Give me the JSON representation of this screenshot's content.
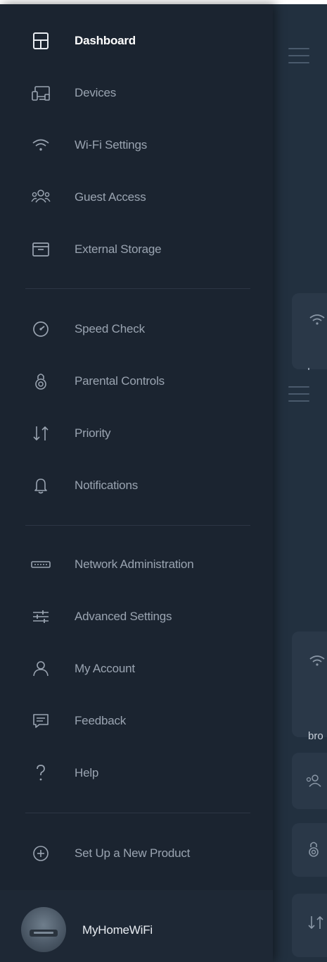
{
  "drawer": {
    "accent_color": "#ffffff",
    "label_color": "#9aa4b1",
    "groups": [
      [
        {
          "label": "Dashboard",
          "icon": "dashboard-icon",
          "active": true
        },
        {
          "label": "Devices",
          "icon": "devices-icon"
        },
        {
          "label": "Wi-Fi Settings",
          "icon": "wifi-icon"
        },
        {
          "label": "Guest Access",
          "icon": "guest-access-icon"
        },
        {
          "label": "External Storage",
          "icon": "storage-box-icon"
        }
      ],
      [
        {
          "label": "Speed Check",
          "icon": "speedometer-icon"
        },
        {
          "label": "Parental Controls",
          "icon": "parental-controls-icon"
        },
        {
          "label": "Priority",
          "icon": "priority-arrows-icon"
        },
        {
          "label": "Notifications",
          "icon": "bell-icon"
        }
      ],
      [
        {
          "label": "Network Administration",
          "icon": "router-icon"
        },
        {
          "label": "Advanced Settings",
          "icon": "sliders-icon"
        },
        {
          "label": "My Account",
          "icon": "person-icon"
        },
        {
          "label": "Feedback",
          "icon": "feedback-icon"
        },
        {
          "label": "Help",
          "icon": "question-icon"
        }
      ],
      [
        {
          "label": "Set Up a New Product",
          "icon": "add-circle-icon"
        }
      ]
    ]
  },
  "account": {
    "network_name": "MyHomeWiFi",
    "avatar_icon": "router-avatar-icon"
  },
  "background": {
    "peek_text": "bro"
  }
}
